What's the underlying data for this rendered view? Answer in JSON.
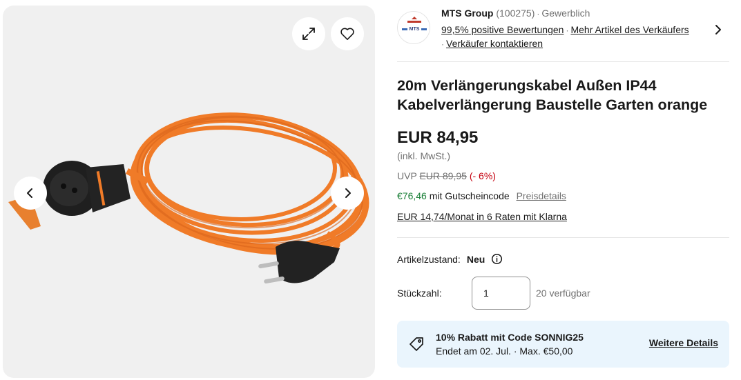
{
  "gallery": {
    "expand_icon": "expand-icon",
    "watch_icon": "heart-icon",
    "prev_icon": "chevron-left-icon",
    "next_icon": "chevron-right-icon",
    "image_alt_subject": "orange extension cable"
  },
  "seller": {
    "name": "MTS Group",
    "feedback_count": "(100275)",
    "type": "Gewerblich",
    "positive": "99,5% positive Bewertungen",
    "more_items": "Mehr Artikel des Verkäufers",
    "contact": "Verkäufer kontaktieren",
    "logo_text": "MTS"
  },
  "product": {
    "title": "20m Verlängerungskabel Außen IP44 Kabelverlängerung Baustelle Garten orange",
    "price": "EUR 84,95",
    "vat": "(inkl. MwSt.)",
    "uvp_label": "UVP",
    "uvp_price": "EUR 89,95",
    "uvp_discount": "(- 6%)",
    "coupon_price": "€76,46",
    "coupon_text": "mit Gutscheincode",
    "price_details": "Preisdetails",
    "klarna": "EUR 14,74/Monat in 6 Raten mit Klarna"
  },
  "condition": {
    "label": "Artikelzustand:",
    "value": "Neu"
  },
  "quantity": {
    "label": "Stückzahl:",
    "value": "1",
    "available": "20 verfügbar"
  },
  "promo": {
    "title": "10% Rabatt mit Code SONNIG25",
    "subtitle": "Endet am 02. Jul. · Max. €50,00",
    "link": "Weitere Details"
  },
  "colors": {
    "accent_blue_bg": "#eaf5fd",
    "discount_red": "#c5000f",
    "coupon_green": "#1a7f37",
    "cable_orange": "#f07b28"
  }
}
